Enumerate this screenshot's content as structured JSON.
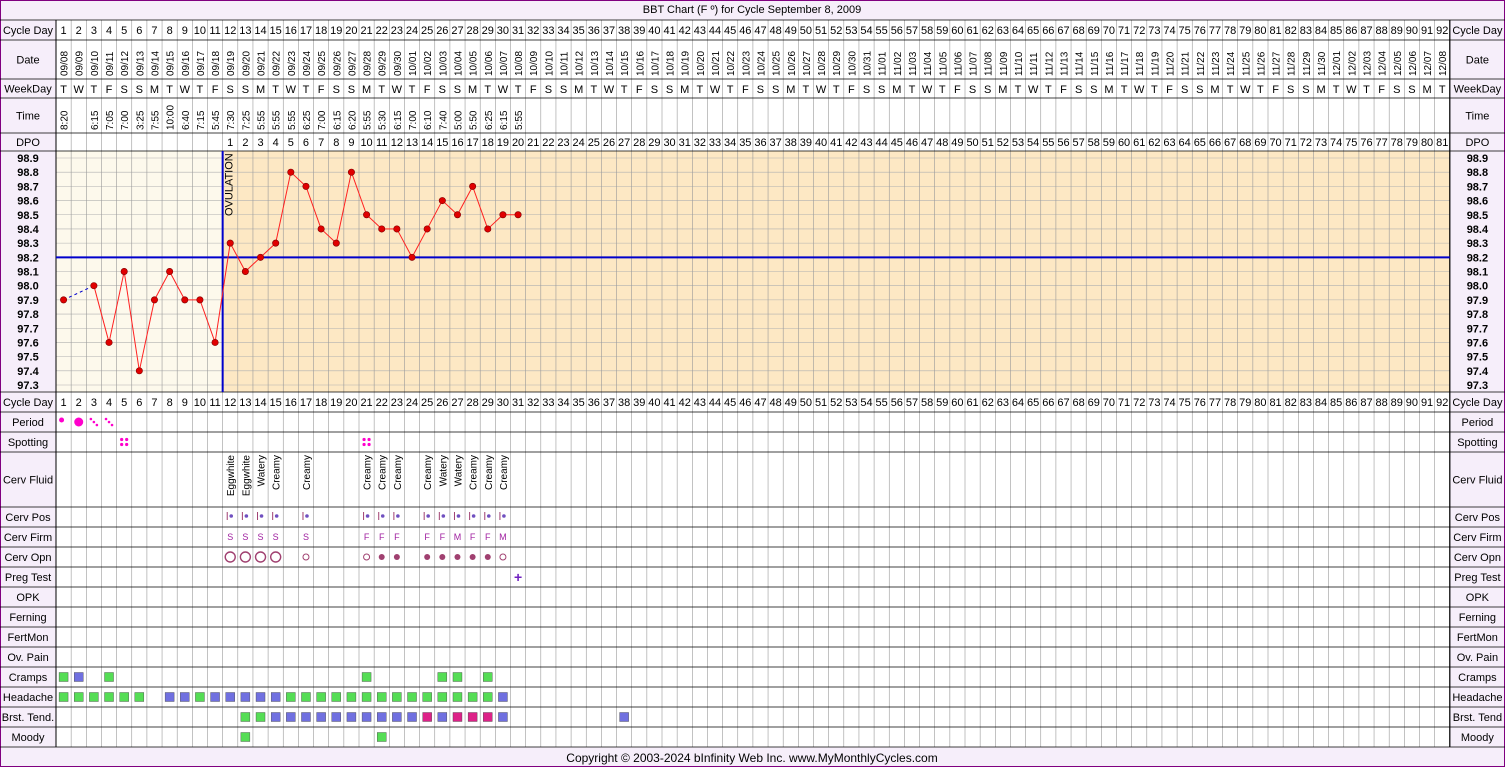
{
  "title": "BBT Chart (F º) for Cycle September 8, 2009",
  "copyright": "Copyright © 2003-2024 bInfinity Web Inc.     www.MyMonthlyCycles.com",
  "colors": {
    "border": "#800080",
    "frame": "#f6eefa",
    "follicular": "#fdf9ec",
    "luteal": "#fde8c4",
    "grid": "#b0b0b0",
    "coverline": "#0000cc",
    "temp_line": "#ff2020",
    "temp_point": "#e00000",
    "period": "#ff00cc",
    "green": "#55dd55",
    "blue": "#7070e0",
    "pink": "#dd2288",
    "mucus": "#a04070"
  },
  "row_labels": {
    "cycle_day": "Cycle Day",
    "date": "Date",
    "weekday": "WeekDay",
    "time": "Time",
    "dpo": "DPO",
    "period": "Period",
    "spotting": "Spotting",
    "cerv_fluid": "Cerv Fluid",
    "cerv_pos": "Cerv Pos",
    "cerv_firm": "Cerv Firm",
    "cerv_opn": "Cerv Opn",
    "preg_test": "Preg Test",
    "opk": "OPK",
    "ferning": "Ferning",
    "fertmon": "FertMon",
    "ov_pain": "Ov. Pain",
    "cramps": "Cramps",
    "headache": "Headache",
    "brst_tend": "Brst. Tend.",
    "brst_tend_right": "Brst. Tend",
    "moody": "Moody"
  },
  "ovulation_label": "OVULATION",
  "chart_data": {
    "type": "line",
    "title": "BBT Chart (F º) for Cycle September 8, 2009",
    "days": 92,
    "dates": [
      "09/08",
      "09/09",
      "09/10",
      "09/11",
      "09/12",
      "09/13",
      "09/14",
      "09/15",
      "09/16",
      "09/17",
      "09/18",
      "09/19",
      "09/20",
      "09/21",
      "09/22",
      "09/23",
      "09/24",
      "09/25",
      "09/26",
      "09/27",
      "09/28",
      "09/29",
      "09/30",
      "10/01",
      "10/02",
      "10/03",
      "10/04",
      "10/05",
      "10/06",
      "10/07",
      "10/08",
      "10/09",
      "10/10",
      "10/11",
      "10/12",
      "10/13",
      "10/14",
      "10/15",
      "10/16",
      "10/17",
      "10/18",
      "10/19",
      "10/20",
      "10/21",
      "10/22",
      "10/23",
      "10/24",
      "10/25",
      "10/26",
      "10/27",
      "10/28",
      "10/29",
      "10/30",
      "10/31",
      "11/01",
      "11/02",
      "11/03",
      "11/04",
      "11/05",
      "11/06",
      "11/07",
      "11/08",
      "11/09",
      "11/10",
      "11/11",
      "11/12",
      "11/13",
      "11/14",
      "11/15",
      "11/16",
      "11/17",
      "11/18",
      "11/19",
      "11/20",
      "11/21",
      "11/22",
      "11/23",
      "11/24",
      "11/25",
      "11/26",
      "11/27",
      "11/28",
      "11/29",
      "11/30",
      "12/01",
      "12/02",
      "12/03",
      "12/04",
      "12/05",
      "12/06",
      "12/07",
      "12/08"
    ],
    "weekdays": [
      "T",
      "W",
      "T",
      "F",
      "S",
      "S",
      "M",
      "T",
      "W",
      "T",
      "F",
      "S",
      "S",
      "M",
      "T",
      "W",
      "T",
      "F",
      "S",
      "S",
      "M",
      "T",
      "W",
      "T",
      "F",
      "S",
      "S",
      "M",
      "T",
      "W",
      "T",
      "F",
      "S",
      "S",
      "M",
      "T",
      "W",
      "T",
      "F",
      "S",
      "S",
      "M",
      "T",
      "W",
      "T",
      "F",
      "S",
      "S",
      "M",
      "T",
      "W",
      "T",
      "F",
      "S",
      "S",
      "M",
      "T",
      "W",
      "T",
      "F",
      "S",
      "S",
      "M",
      "T",
      "W",
      "T",
      "F",
      "S",
      "S",
      "M",
      "T",
      "W",
      "T",
      "F",
      "S",
      "S",
      "M",
      "T",
      "W",
      "T",
      "F",
      "S",
      "S",
      "M",
      "T",
      "W",
      "T",
      "F",
      "S",
      "S",
      "M",
      "T"
    ],
    "times": [
      "8:20",
      "",
      "6:15",
      "7:05",
      "7:00",
      "3:25",
      "7:55",
      "10:00",
      "6:40",
      "7:15",
      "5:45",
      "7:30",
      "7:25",
      "5:55",
      "5:55",
      "5:55",
      "6:25",
      "7:00",
      "6:15",
      "6:20",
      "5:55",
      "5:30",
      "6:15",
      "7:00",
      "6:10",
      "7:40",
      "5:00",
      "5:50",
      "6:25",
      "6:15",
      "5:55"
    ],
    "dpo_start_day": 12,
    "dpo_max": 81,
    "temperatures": [
      97.9,
      null,
      98.0,
      97.6,
      98.1,
      97.4,
      97.9,
      98.1,
      97.9,
      97.9,
      97.6,
      98.3,
      98.1,
      98.2,
      98.3,
      98.8,
      98.7,
      98.4,
      98.3,
      98.8,
      98.5,
      98.4,
      98.4,
      98.2,
      98.4,
      98.6,
      98.5,
      98.7,
      98.4,
      98.5,
      98.5
    ],
    "ylim": [
      97.3,
      98.9
    ],
    "y_ticks": [
      "98.9",
      "98.8",
      "98.7",
      "98.6",
      "98.5",
      "98.4",
      "98.3",
      "98.2",
      "98.1",
      "98.0",
      "97.9",
      "97.8",
      "97.7",
      "97.6",
      "97.5",
      "97.4",
      "97.3"
    ],
    "coverline": 98.2,
    "ovulation_day": 11,
    "period": {
      "1": "dot-small",
      "2": "dot-large",
      "3": "dots-light",
      "4": "dots-light"
    },
    "spotting_days": [
      5,
      21
    ],
    "cerv_fluid": {
      "12": "Eggwhite",
      "13": "Eggwhite",
      "14": "Watery",
      "15": "Creamy",
      "17": "Creamy",
      "21": "Creamy",
      "22": "Creamy",
      "23": "Creamy",
      "25": "Creamy",
      "26": "Watery",
      "27": "Watery",
      "28": "Creamy",
      "29": "Creamy",
      "30": "Creamy"
    },
    "cerv_pos": [
      12,
      13,
      14,
      15,
      17,
      21,
      22,
      23,
      25,
      26,
      27,
      28,
      29,
      30
    ],
    "cerv_firm": {
      "12": "S",
      "13": "S",
      "14": "S",
      "15": "S",
      "17": "S",
      "21": "F",
      "22": "F",
      "23": "F",
      "25": "F",
      "26": "F",
      "27": "M",
      "28": "F",
      "29": "F",
      "30": "M"
    },
    "cerv_opn": {
      "12": "open",
      "13": "open",
      "14": "open",
      "15": "open",
      "17": "small",
      "21": "small",
      "22": "dot",
      "23": "dot",
      "25": "dot",
      "26": "dot",
      "27": "dot",
      "28": "dot",
      "29": "dot",
      "30": "small"
    },
    "preg_test": {
      "31": "+"
    },
    "cramps": {
      "1": "green",
      "2": "blue",
      "4": "green",
      "21": "green",
      "26": "green",
      "27": "green",
      "29": "green"
    },
    "headache": {
      "1": "green",
      "2": "green",
      "3": "green",
      "4": "green",
      "5": "green",
      "6": "green",
      "8": "blue",
      "9": "blue",
      "10": "green",
      "11": "blue",
      "12": "blue",
      "13": "blue",
      "14": "blue",
      "15": "blue",
      "16": "green",
      "17": "green",
      "18": "green",
      "19": "green",
      "20": "green",
      "21": "green",
      "22": "green",
      "23": "green",
      "24": "green",
      "25": "green",
      "26": "green",
      "27": "green",
      "28": "green",
      "29": "green",
      "30": "blue"
    },
    "brst_tend": {
      "13": "green",
      "14": "green",
      "15": "blue",
      "16": "blue",
      "17": "blue",
      "18": "blue",
      "19": "blue",
      "20": "blue",
      "21": "blue",
      "22": "blue",
      "23": "blue",
      "24": "blue",
      "25": "pink",
      "26": "blue",
      "27": "pink",
      "28": "pink",
      "29": "pink",
      "30": "blue",
      "38": "blue"
    },
    "moody": {
      "13": "green",
      "22": "green"
    }
  }
}
